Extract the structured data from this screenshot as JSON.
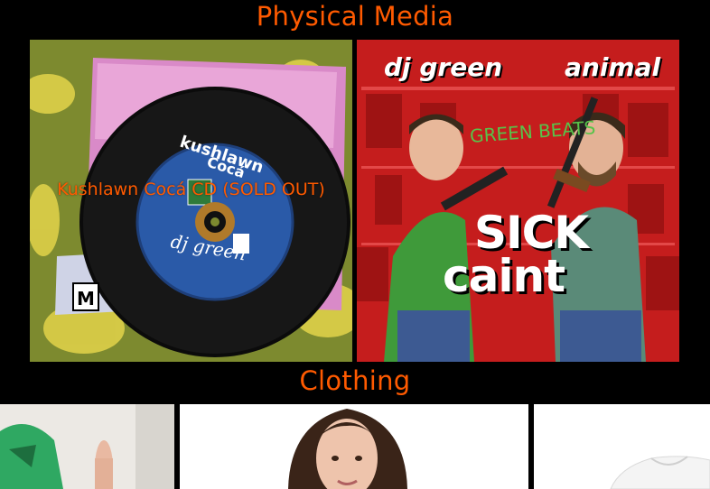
{
  "sections": {
    "physical_media": "Physical Media",
    "clothing": "Clothing"
  },
  "products": {
    "cd": {
      "overlay_label": "Kushlawn Cocá CD (SOLD OUT)"
    },
    "sick_caint": {
      "artist_left": "dj green",
      "artist_right": "animal",
      "tag": "GREEN BEATS",
      "title_line1": "SICK",
      "title_line2": "caint"
    }
  },
  "colors": {
    "accent": "#ff5a00",
    "background": "#000000",
    "album_red": "#c51d1d"
  }
}
